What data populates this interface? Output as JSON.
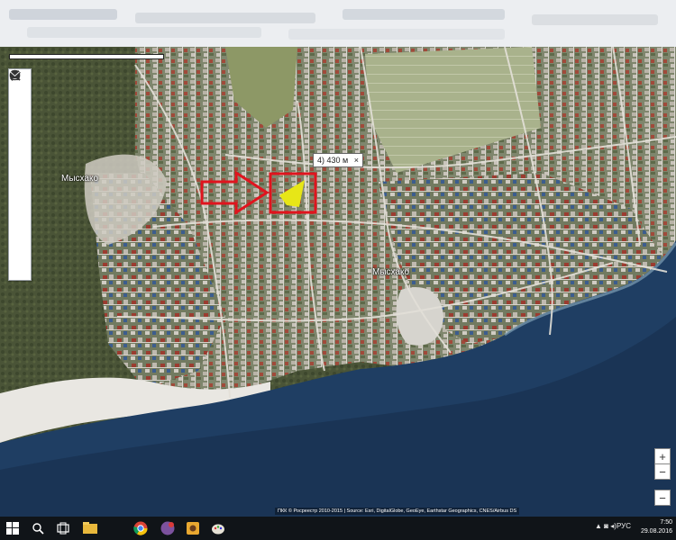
{
  "map": {
    "places": [
      {
        "id": "place-west",
        "label": "Мысхако"
      },
      {
        "id": "place-center",
        "label": "Мысхако"
      }
    ],
    "measurement": {
      "label": "4) 430 м",
      "close": "×"
    },
    "zoom": {
      "in": "+",
      "out": "−"
    },
    "attribution": "ПКК © Росреестр 2010-2015 | Source: Esri, DigitalGlobe, GeoEye, Earthstar Geographics, CNES/Airbus DS",
    "tools": [
      {
        "name": "pencil-icon"
      },
      {
        "name": "search-icon"
      },
      {
        "name": "info-icon"
      },
      {
        "name": "layers-icon"
      },
      {
        "name": "ruler-icon"
      },
      {
        "name": "star-icon"
      },
      {
        "name": "print-icon"
      },
      {
        "name": "help-icon"
      },
      {
        "name": "mail-icon"
      }
    ],
    "colors": {
      "highlight_box": "#e0141e",
      "arrow": "#e0141e",
      "polygon": "#e7e617",
      "sea": "#1f3e63"
    }
  },
  "taskbar": {
    "language": "РУС",
    "time": "7:50",
    "date": "29.08.2016",
    "icons": [
      "windows-start-icon",
      "search-icon",
      "task-view-icon",
      "file-explorer-icon",
      "chrome-icon",
      "viber-icon",
      "app-icon",
      "paint-icon"
    ]
  }
}
